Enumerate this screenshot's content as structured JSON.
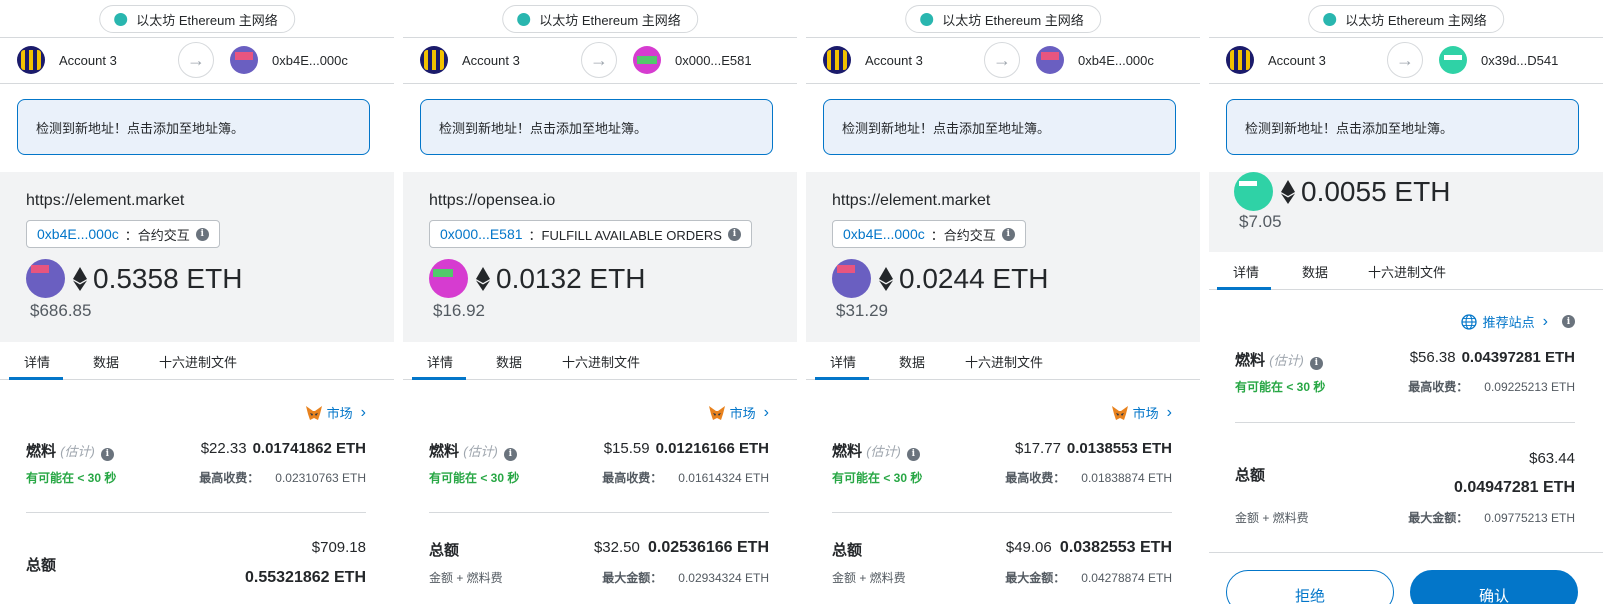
{
  "network_label": "以太坊 Ethereum 主网络",
  "from_account": "Account 3",
  "banner": "检测到新地址！点击添加至地址簿。",
  "tabs": [
    "详情",
    "数据",
    "十六进制文件"
  ],
  "fee_label": "燃料",
  "fee_estimate_label": "(估计)",
  "likely_label": "有可能在 < 30 秒",
  "max_fee_label": "最高收费：",
  "total_label": "总额",
  "total_sub_label": "金额 + 燃料费",
  "max_amount_label": "最大金额：",
  "site_label_market": "市场",
  "site_label_recommended": "推荐站点",
  "colors": {
    "accent": "#0376c9",
    "success": "#28a745",
    "network_dot": "#29b6af"
  },
  "panels": [
    {
      "to_address": "0xb4E...000c",
      "origin": "https://element.market",
      "method_address": "0xb4E...000c",
      "method_name": "：合约交互",
      "amount": "0.5358 ETH",
      "amount_usd": "$686.85",
      "fee_usd": "$22.33",
      "fee_eth": "0.01741862 ETH",
      "max_fee": "0.02310763 ETH",
      "total_usd": "$709.18",
      "total_eth": "0.55321862 ETH"
    },
    {
      "to_address": "0x000...E581",
      "origin": "https://opensea.io",
      "method_address": "0x000...E581",
      "method_name": "：FULFILL AVAILABLE ORDERS",
      "amount": "0.0132 ETH",
      "amount_usd": "$16.92",
      "fee_usd": "$15.59",
      "fee_eth": "0.01216166 ETH",
      "max_fee": "0.01614324 ETH",
      "total_usd": "$32.50",
      "total_eth": "0.02536166 ETH",
      "max_amount": "0.02934324 ETH"
    },
    {
      "to_address": "0xb4E...000c",
      "origin": "https://element.market",
      "method_address": "0xb4E...000c",
      "method_name": "：合约交互",
      "amount": "0.0244 ETH",
      "amount_usd": "$31.29",
      "fee_usd": "$17.77",
      "fee_eth": "0.0138553 ETH",
      "max_fee": "0.01838874 ETH",
      "total_usd": "$49.06",
      "total_eth": "0.0382553 ETH",
      "max_amount": "0.04278874 ETH"
    },
    {
      "to_address": "0x39d...D541",
      "amount": "0.0055 ETH",
      "amount_usd": "$7.05",
      "fee_usd": "$56.38",
      "fee_eth": "0.04397281 ETH",
      "max_fee": "0.09225213 ETH",
      "total_usd": "$63.44",
      "total_eth": "0.04947281 ETH",
      "max_amount": "0.09775213 ETH",
      "reject_label": "拒绝",
      "confirm_label": "确认"
    }
  ]
}
